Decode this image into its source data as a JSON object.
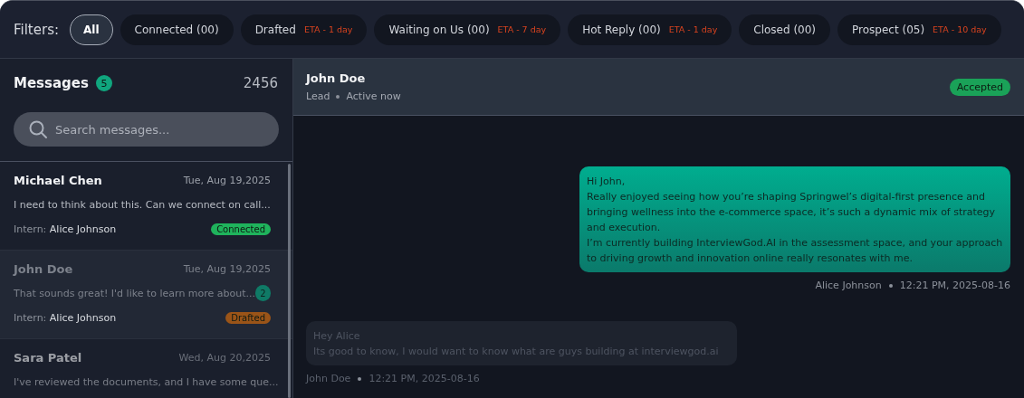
{
  "filters": {
    "label": "Filters:",
    "chips": [
      {
        "label": "All",
        "selected": true
      },
      {
        "label": "Connected (00)",
        "selected": false
      },
      {
        "label": "Drafted",
        "eta": "ETA - 1 day",
        "selected": false
      },
      {
        "label": "Waiting on Us (00)",
        "eta": "ETA - 7 day",
        "selected": false
      },
      {
        "label": "Hot Reply (00)",
        "eta": "ETA - 1 day",
        "selected": false
      },
      {
        "label": "Closed (00)",
        "selected": false
      },
      {
        "label": "Prospect (05)",
        "eta": "ETA - 10 day",
        "selected": false
      }
    ]
  },
  "sidebar": {
    "title": "Messages",
    "badge": "5",
    "total": "2456",
    "search": {
      "placeholder": "Search messages..."
    },
    "conversations": [
      {
        "name": "Michael Chen",
        "date": "Tue, Aug 19,2025",
        "preview": "I need to think about this. Can we connect on call...",
        "intern_label": "Intern:",
        "intern": "Alice Johnson",
        "tag": {
          "label": "Connected",
          "color": "#1fb35c"
        },
        "selected": false
      },
      {
        "name": "John Doe",
        "date": "Tue, Aug 19,2025",
        "preview": "That sounds great! I'd like to learn more about...",
        "unread": "2",
        "intern_label": "Intern:",
        "intern": "Alice Johnson",
        "tag": {
          "label": "Drafted",
          "color": "#9a5418"
        },
        "selected": true
      },
      {
        "name": "Sara Patel",
        "date": "Wed, Aug 20,2025",
        "preview": "I've reviewed the documents, and I have some que...",
        "selected": false
      }
    ]
  },
  "chat": {
    "header": {
      "name": "John Doe",
      "role": "Lead",
      "presence": "Active now",
      "status": "Accepted"
    },
    "messages": [
      {
        "kind": "outgoing",
        "lines": [
          "Hi John,",
          "Really enjoyed seeing how you’re shaping Springwel’s digital-first presence and bringing wellness into the e-commerce space, it’s such a dynamic mix of strategy and execution.",
          "I’m currently building InterviewGod.AI in the assessment space, and your approach to driving growth and innovation online really resonates with me."
        ],
        "sender": "Alice Johnson",
        "time": "12:21 PM, 2025-08-16"
      },
      {
        "kind": "incoming",
        "lines": [
          "Hey Alice",
          "Its good to know, I would want to know what are guys building at interviewgod.ai"
        ],
        "sender": "John Doe",
        "time": "12:21 PM, 2025-08-16"
      }
    ]
  }
}
